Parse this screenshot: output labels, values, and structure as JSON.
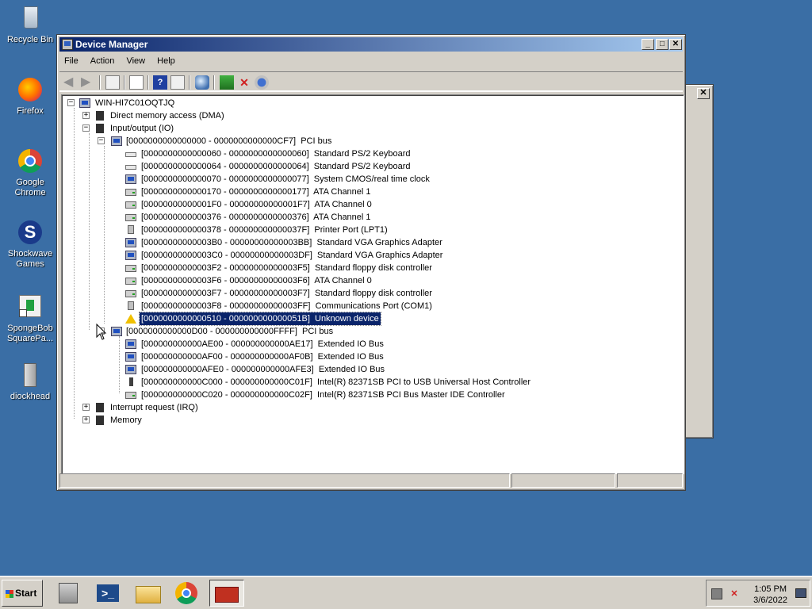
{
  "desktop": {
    "icons": [
      {
        "label": "Recycle Bin"
      },
      {
        "label": "Firefox"
      },
      {
        "label": "Google Chrome"
      },
      {
        "label": "Shockwave Games"
      },
      {
        "label": "SpongeBob SquarePa..."
      },
      {
        "label": "diockhead"
      }
    ]
  },
  "window": {
    "title": "Device Manager",
    "menu": [
      "File",
      "Action",
      "View",
      "Help"
    ]
  },
  "tree": {
    "root": "WIN-HI7C01OQTJQ",
    "dma": "Direct memory access (DMA)",
    "io": "Input/output (IO)",
    "pci1": {
      "range": "[0000000000000000 - 0000000000000CF7]",
      "name": "PCI bus",
      "children": [
        {
          "range": "[0000000000000060 - 0000000000000060]",
          "name": "Standard PS/2 Keyboard"
        },
        {
          "range": "[0000000000000064 - 0000000000000064]",
          "name": "Standard PS/2 Keyboard"
        },
        {
          "range": "[0000000000000070 - 0000000000000077]",
          "name": "System CMOS/real time clock"
        },
        {
          "range": "[0000000000000170 - 0000000000000177]",
          "name": "ATA Channel 1"
        },
        {
          "range": "[00000000000001F0 - 00000000000001F7]",
          "name": "ATA Channel 0"
        },
        {
          "range": "[0000000000000376 - 0000000000000376]",
          "name": "ATA Channel 1"
        },
        {
          "range": "[0000000000000378 - 000000000000037F]",
          "name": "Printer Port (LPT1)"
        },
        {
          "range": "[00000000000003B0 - 00000000000003BB]",
          "name": "Standard VGA Graphics Adapter"
        },
        {
          "range": "[00000000000003C0 - 00000000000003DF]",
          "name": "Standard VGA Graphics Adapter"
        },
        {
          "range": "[00000000000003F2 - 00000000000003F5]",
          "name": "Standard floppy disk controller"
        },
        {
          "range": "[00000000000003F6 - 00000000000003F6]",
          "name": "ATA Channel 0"
        },
        {
          "range": "[00000000000003F7 - 00000000000003F7]",
          "name": "Standard floppy disk controller"
        },
        {
          "range": "[00000000000003F8 - 00000000000003FF]",
          "name": "Communications Port (COM1)"
        },
        {
          "range": "[0000000000000510 - 000000000000051B]",
          "name": "Unknown device"
        }
      ]
    },
    "pci2": {
      "range": "[0000000000000D00 - 000000000000FFFF]",
      "name": "PCI bus",
      "children": [
        {
          "range": "[000000000000AE00 - 000000000000AE17]",
          "name": "Extended IO Bus"
        },
        {
          "range": "[000000000000AF00 - 000000000000AF0B]",
          "name": "Extended IO Bus"
        },
        {
          "range": "[000000000000AFE0 - 000000000000AFE3]",
          "name": "Extended IO Bus"
        },
        {
          "range": "[000000000000C000 - 000000000000C01F]",
          "name": "Intel(R) 82371SB PCI to USB Universal Host Controller"
        },
        {
          "range": "[000000000000C020 - 000000000000C02F]",
          "name": "Intel(R) 82371SB PCI Bus Master IDE Controller"
        }
      ]
    },
    "irq": "Interrupt request (IRQ)",
    "memory": "Memory"
  },
  "taskbar": {
    "start": "Start",
    "time": "1:05 PM",
    "date": "3/6/2022"
  },
  "colors": {
    "desktop": "#3a6ea5",
    "selection": "#0a246a",
    "title_start": "#0a246a"
  }
}
